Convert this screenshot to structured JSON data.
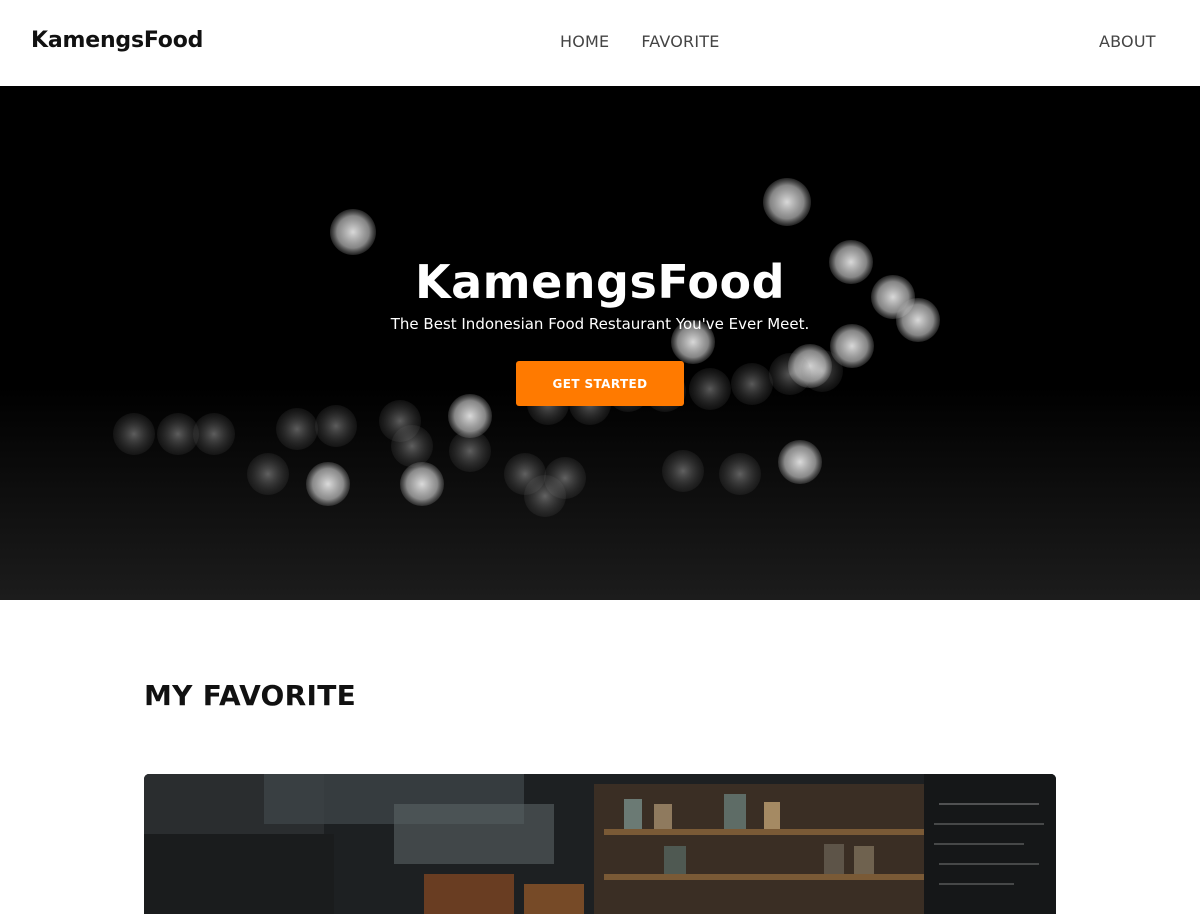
{
  "navbar": {
    "brand": "KamengsFood",
    "links": [
      {
        "label": "HOME"
      },
      {
        "label": "FAVORITE"
      }
    ],
    "about": "ABOUT"
  },
  "hero": {
    "title": "KamengsFood",
    "subtitle": "The Best Indonesian Food Restaurant You've Ever Meet.",
    "cta_label": "GET STARTED",
    "cta_color": "#ff7a00",
    "background_color": "#000000"
  },
  "favorite": {
    "title": "MY FAVORITE"
  }
}
